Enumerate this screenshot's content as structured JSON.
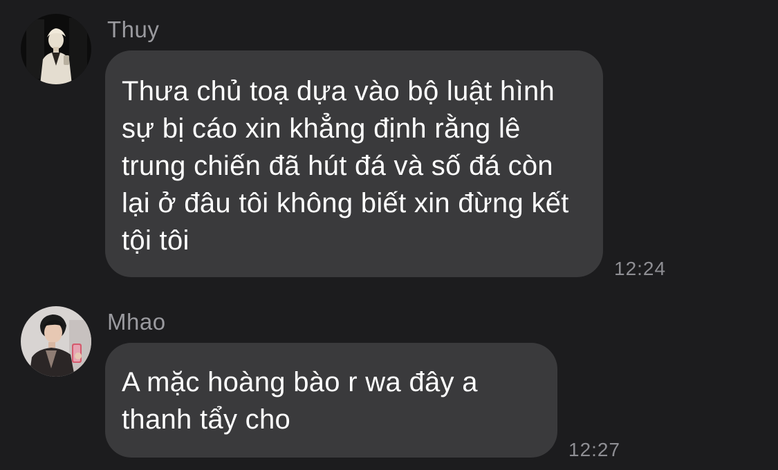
{
  "messages": [
    {
      "sender": "Thuy",
      "text": "Thưa chủ toạ dựa vào bộ luật hình sự bị cáo xin khẳng định rằng lê trung chiến đã hút đá và số đá còn lại ở đâu tôi không biết xin đừng kết tội tôi",
      "time": "12:24"
    },
    {
      "sender": "Mhao",
      "text": "A mặc hoàng bào r wa đây a thanh tẩy cho",
      "time": "12:27"
    }
  ],
  "colors": {
    "background": "#1c1c1e",
    "bubble": "#3a3a3c",
    "sender_name": "#9a9a9f",
    "timestamp": "#8e8e93",
    "message_text": "#ffffff"
  }
}
